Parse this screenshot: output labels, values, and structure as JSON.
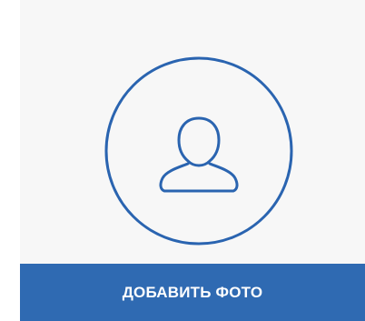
{
  "add_photo": {
    "button_label": "ДОБАВИТЬ ФОТО"
  },
  "icons": {
    "avatar": "user-profile-icon"
  },
  "colors": {
    "card_background": "#f7f7f7",
    "accent": "#2a64b0",
    "button_background": "#2f6ab2",
    "button_text": "#ffffff"
  }
}
